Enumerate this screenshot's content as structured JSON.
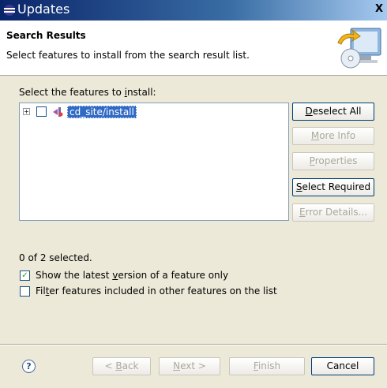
{
  "window": {
    "title": "Updates",
    "close_label": "X"
  },
  "header": {
    "title": "Search Results",
    "description": "Select features to install from the search result list."
  },
  "features": {
    "label_prefix": "Select the features to ",
    "label_mnemonic": "i",
    "label_suffix": "nstall:",
    "tree": [
      {
        "label": "cd_site/install",
        "checked": false,
        "expanded": false,
        "selected": true
      }
    ]
  },
  "side_buttons": {
    "deselect_all": {
      "mnemonic": "D",
      "rest": "eselect All"
    },
    "more_info": {
      "mnemonic": "M",
      "rest": "ore Info"
    },
    "properties": {
      "mnemonic": "P",
      "rest": "roperties"
    },
    "select_required": {
      "mnemonic": "S",
      "rest": "elect Required"
    },
    "error_details": {
      "mnemonic": "E",
      "rest": "rror Details..."
    }
  },
  "status": {
    "selected_count": "0 of 2 selected."
  },
  "options": {
    "show_latest": {
      "checked": true,
      "pre": "Show the latest ",
      "mnemonic": "v",
      "post": "ersion of a feature only"
    },
    "filter_included": {
      "checked": false,
      "pre": "Fil",
      "mnemonic": "t",
      "post": "er features included in other features on the list"
    }
  },
  "footer": {
    "help_label": "?",
    "back": {
      "pre": "< ",
      "mnemonic": "B",
      "post": "ack"
    },
    "next": {
      "pre": "",
      "mnemonic": "N",
      "post": "ext >"
    },
    "finish": {
      "pre": "",
      "mnemonic": "F",
      "post": "inish"
    },
    "cancel": "Cancel"
  },
  "colors": {
    "selection": "#316ac5",
    "dialog_bg": "#ece9d8",
    "titlebar": "#0a246a"
  }
}
